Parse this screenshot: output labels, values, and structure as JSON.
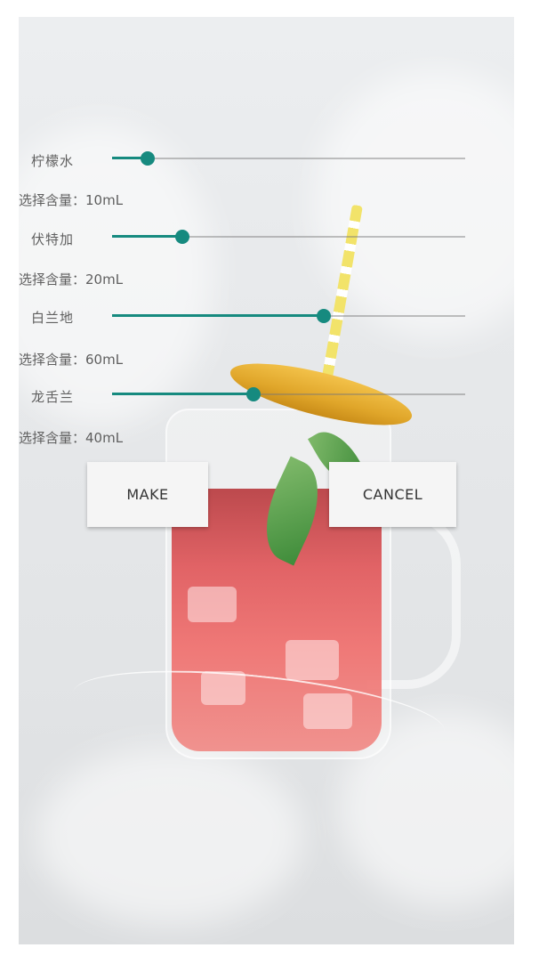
{
  "ingredients": [
    {
      "name": "柠檬水",
      "amount_text": "选择含量：10mL",
      "level": 0.1
    },
    {
      "name": "伏特加",
      "amount_text": "选择含量：20mL",
      "level": 0.2
    },
    {
      "name": "白兰地",
      "amount_text": "选择含量：60mL",
      "level": 0.6
    },
    {
      "name": "龙舌兰",
      "amount_text": "选择含量：40mL",
      "level": 0.4
    }
  ],
  "buttons": {
    "make_label": "MAKE",
    "cancel_label": "CANCEL"
  },
  "colors": {
    "accent": "#168a7f",
    "button_bg": "#f5f5f5"
  },
  "background_image": "cocktail-jar-photo"
}
